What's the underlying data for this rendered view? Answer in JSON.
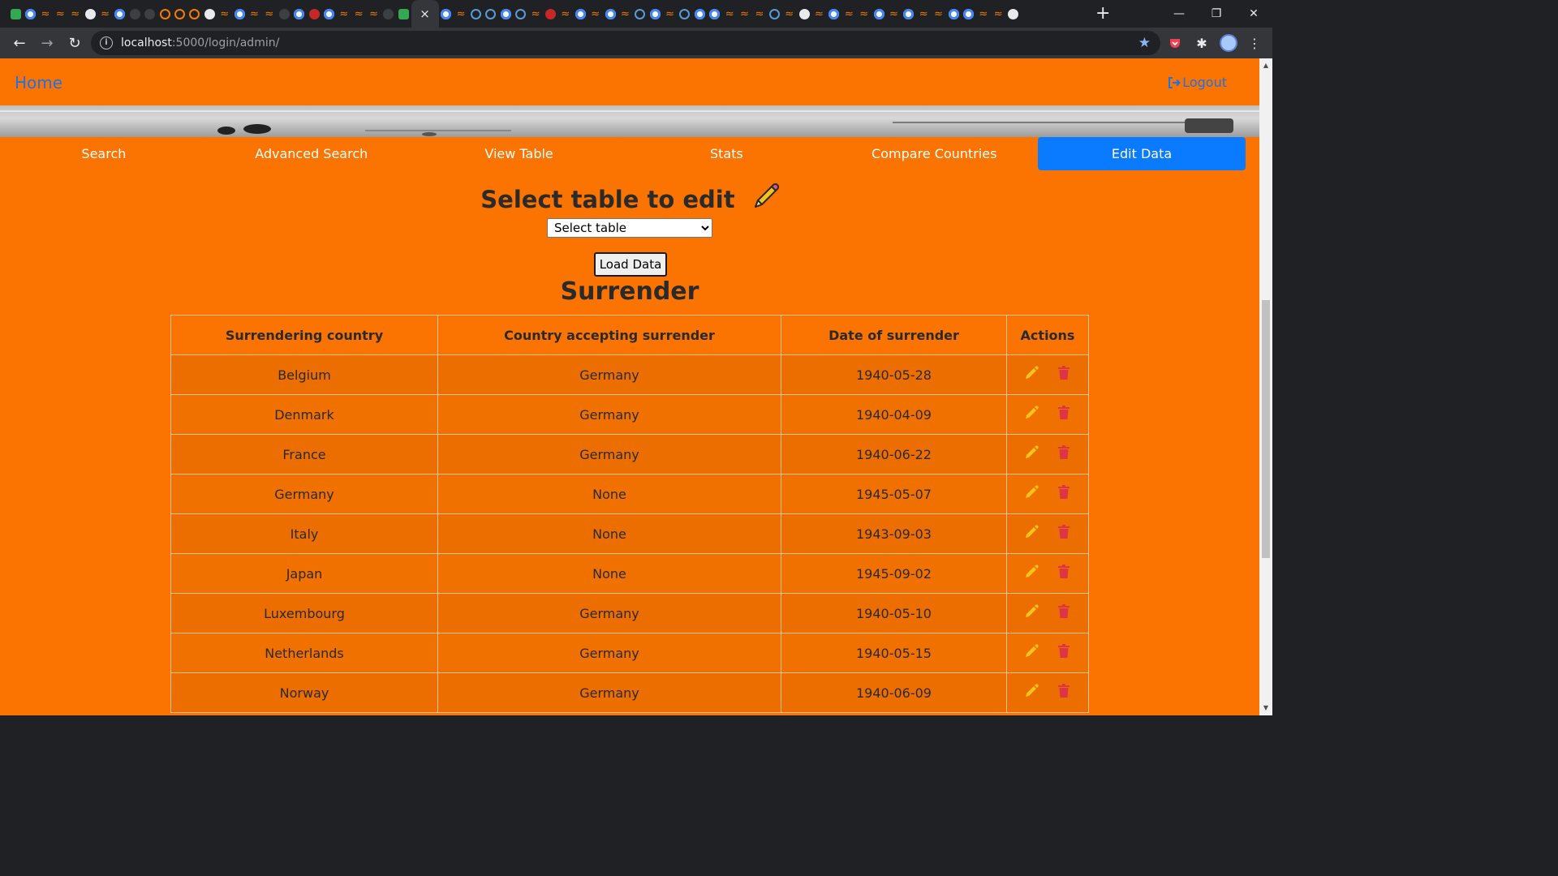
{
  "browser": {
    "url_host": "localhost",
    "url_rest": ":5000/login/admin/",
    "active_tab_close": "×",
    "new_tab": "+"
  },
  "nav": {
    "home": "Home",
    "logout": "Logout"
  },
  "menu": {
    "items": [
      "Search",
      "Advanced Search",
      "View Table",
      "Stats",
      "Compare Countries",
      "Edit Data"
    ],
    "active": "Edit Data"
  },
  "edit": {
    "title": "Select table to edit",
    "select_value": "Select table",
    "load_button": "Load Data"
  },
  "table": {
    "title": "Surrender",
    "columns": [
      "Surrendering country",
      "Country accepting surrender",
      "Date of surrender",
      "Actions"
    ],
    "rows": [
      [
        "Belgium",
        "Germany",
        "1940-05-28"
      ],
      [
        "Denmark",
        "Germany",
        "1940-04-09"
      ],
      [
        "France",
        "Germany",
        "1940-06-22"
      ],
      [
        "Germany",
        "None",
        "1945-05-07"
      ],
      [
        "Italy",
        "None",
        "1943-09-03"
      ],
      [
        "Japan",
        "None",
        "1945-09-02"
      ],
      [
        "Luxembourg",
        "Germany",
        "1940-05-10"
      ],
      [
        "Netherlands",
        "Germany",
        "1940-05-15"
      ],
      [
        "Norway",
        "Germany",
        "1940-06-09"
      ]
    ]
  },
  "colors": {
    "page_bg": "#fb7401",
    "link": "#1a73e8",
    "active_menu": "#0a7bff",
    "edit_icon": "#f5c518",
    "delete_icon": "#dc3545"
  }
}
